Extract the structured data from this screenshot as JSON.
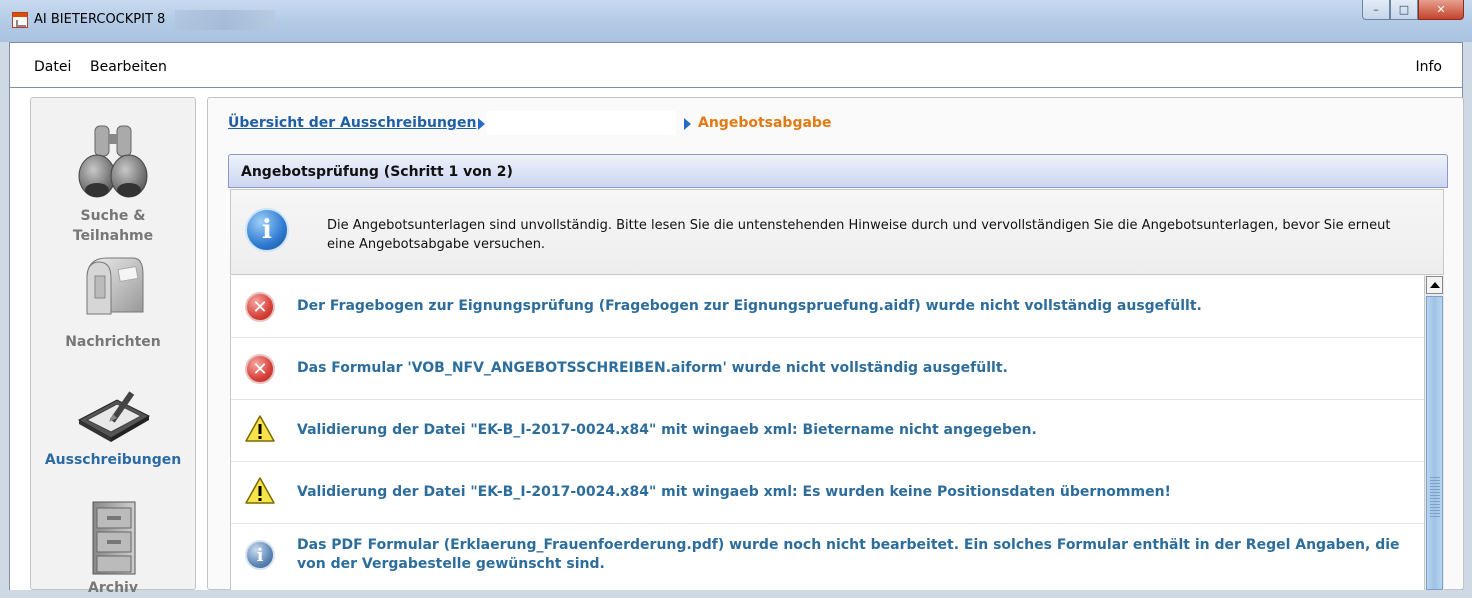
{
  "window": {
    "title": "AI BIETERCOCKPIT 8",
    "btn_min": "–",
    "btn_max": "□",
    "btn_close": "✕"
  },
  "menu": {
    "datei": "Datei",
    "bearbeiten": "Bearbeiten",
    "info": "Info"
  },
  "sidebar": {
    "items": [
      {
        "label": "Suche &\nTeilnahme",
        "icon": "binoculars-icon"
      },
      {
        "label": "Nachrichten",
        "icon": "mailbox-icon"
      },
      {
        "label": "Ausschreibungen",
        "icon": "tablet-pen-icon",
        "active": true
      },
      {
        "label": "Archiv",
        "icon": "file-cabinet-icon"
      }
    ]
  },
  "breadcrumb": {
    "link": "Übersicht der Ausschreibungen",
    "current": "Angebotsabgabe"
  },
  "section": {
    "title": "Angebotsprüfung (Schritt 1 von 2)"
  },
  "info_box": {
    "text": "Die Angebotsunterlagen sind unvollständig. Bitte lesen Sie die untenstehenden Hinweise durch und vervollständigen Sie die Angebotsunterlagen, bevor Sie erneut eine Angebotsabgabe versuchen."
  },
  "messages": [
    {
      "type": "error",
      "icon": "error-icon",
      "text": "Der Fragebogen zur Eignungsprüfung (Fragebogen zur Eignungspruefung.aidf) wurde nicht vollständig ausgefüllt."
    },
    {
      "type": "error",
      "icon": "error-icon",
      "text": "Das Formular 'VOB_NFV_ANGEBOTSSCHREIBEN.aiform' wurde nicht vollständig ausgefüllt."
    },
    {
      "type": "warning",
      "icon": "warning-icon",
      "text": "Validierung der Datei \"EK-B_I-2017-0024.x84\" mit wingaeb xml: Bietername nicht angegeben."
    },
    {
      "type": "warning",
      "icon": "warning-icon",
      "text": "Validierung der Datei \"EK-B_I-2017-0024.x84\" mit wingaeb xml: Es wurden keine Positionsdaten übernommen!"
    },
    {
      "type": "info",
      "icon": "info-icon",
      "text": "Das PDF Formular (Erklaerung_Frauenfoerderung.pdf) wurde noch nicht bearbeitet. Ein solches Formular enthält in der Regel Angaben, die von der Vergabestelle gewünscht sind."
    }
  ]
}
